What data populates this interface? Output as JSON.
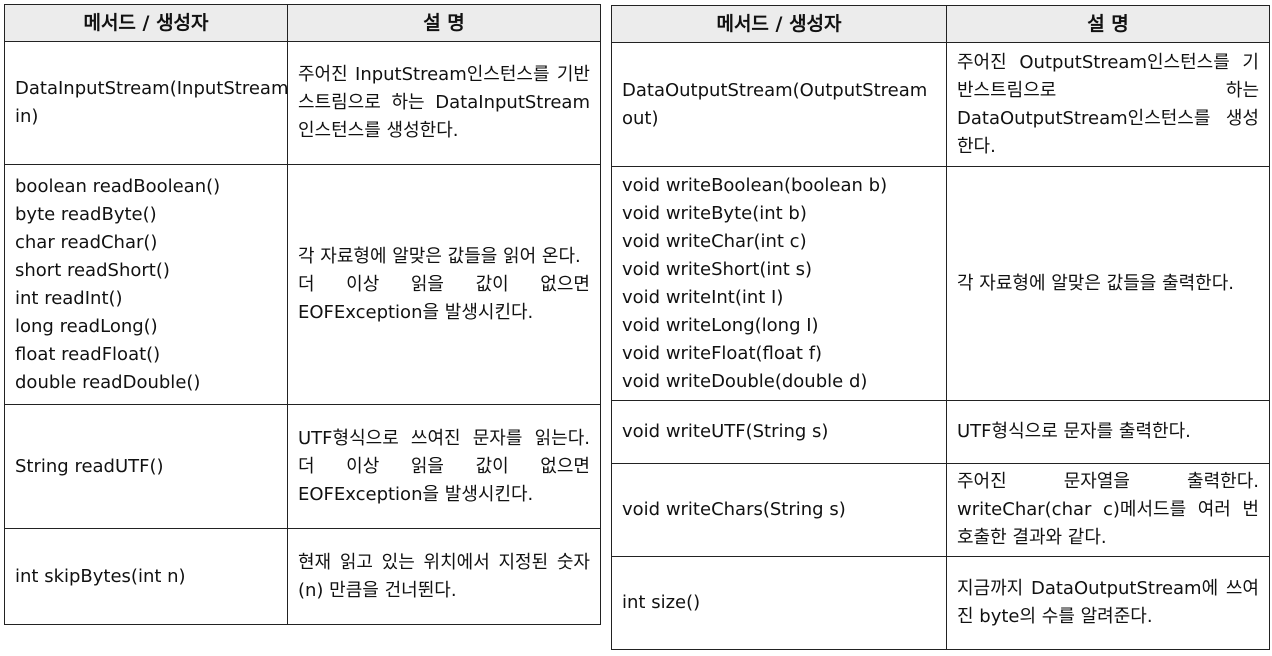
{
  "headers": {
    "method": "메서드 / 생성자",
    "description": "설  명"
  },
  "left_table": {
    "rows": [
      {
        "method": "DataInputStream(InputStream in)",
        "description": "주어진 InputStream인스턴스를 기반스트림으로 하는 DataInputStream인스턴스를 생성한다."
      },
      {
        "method": "boolean readBoolean()\nbyte readByte()\nchar readChar()\nshort readShort()\nint readInt()\nlong readLong()\nfloat readFloat()\ndouble readDouble()",
        "description": "각 자료형에 알맞은 값들을 읽어 온다.\n 더 이상 읽을 값이 없으면 EOFException을 발생시킨다."
      },
      {
        "method": "String readUTF()",
        "description": "UTF형식으로 쓰여진 문자를 읽는다. 더 이상 읽을 값이 없으면 EOFException을 발생시킨다."
      },
      {
        "method": "int skipBytes(int n)",
        "description": "현재 읽고 있는 위치에서 지정된 숫자(n) 만큼을 건너뛴다."
      }
    ]
  },
  "right_table": {
    "rows": [
      {
        "method": "DataOutputStream(OutputStream out)",
        "description": "주어진 OutputStream인스턴스를 기반스트림으로 하는 DataOutputStream인스턴스를 생성한다."
      },
      {
        "method": "void writeBoolean(boolean b)\nvoid writeByte(int b)\nvoid writeChar(int c)\nvoid writeShort(int s)\nvoid writeInt(int I)\nvoid writeLong(long I)\nvoid writeFloat(float f)\nvoid writeDouble(double d)",
        "description": " 각 자료형에 알맞은 값들을 출력한다."
      },
      {
        "method": "void writeUTF(String s)",
        "description": "UTF형식으로 문자를 출력한다."
      },
      {
        "method": "void writeChars(String s)",
        "description": "주어진 문자열을 출력한다. writeChar(char c)메서드를 여러 번 호출한 결과와 같다."
      },
      {
        "method": "int size()",
        "description": "지금까지 DataOutputStream에 쓰여진 byte의 수를 알려준다."
      }
    ]
  }
}
